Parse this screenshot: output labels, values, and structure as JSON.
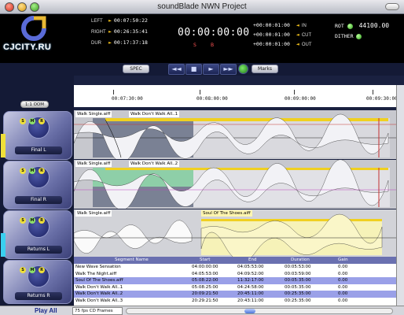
{
  "window": {
    "title": "soundBlade NWN Project"
  },
  "logo": {
    "text": "CJCITY.RU"
  },
  "timecodes": {
    "left": {
      "label": "LEFT",
      "value": "00:07:50:22"
    },
    "right": {
      "label": "RIGHT",
      "value": "00:26:35:41"
    },
    "dur": {
      "label": "DUR",
      "value": "00:17:37:18"
    },
    "main": "00:00:00:00",
    "r1": {
      "label": "IN",
      "value": "+00:00:01:00"
    },
    "r2": {
      "label": "CUT",
      "value": "+00:00:01:00"
    },
    "r3": {
      "label": "OUT",
      "value": "+00:00:01:00"
    },
    "sample_rate": "44100.00",
    "sb_s": "S",
    "sb_b": "B",
    "dither_label": "DITHER",
    "rate_label": "ROT"
  },
  "transport": {
    "left_btn": "SPEC",
    "right_btn": "Marks",
    "rewind": "◄◄",
    "stop": "■",
    "play": "►",
    "ffwd": "►►"
  },
  "zoom": {
    "value": "1:1 OOM"
  },
  "ruler": [
    "00:07:30:00",
    "00:08:00:00",
    "00:09:00:00",
    "00:09:30:00"
  ],
  "tracks": [
    {
      "name": "Final L",
      "clip1": "Walk Single.aiff",
      "clip2": "Walk Don't Walk All..1",
      "accent": "#f0e03a"
    },
    {
      "name": "Final R",
      "clip1": "Walk Single.aiff",
      "clip2": "Walk Don't Walk All..2",
      "accent": "#e8e8ef"
    },
    {
      "name": "Returns L",
      "clip1": "Walk Single.aiff",
      "clip2": "Soul Of The Shoes.aiff",
      "accent": "#3ad0f0"
    },
    {
      "name": "Returns R",
      "clip1": "",
      "clip2": "",
      "accent": "#e8e8ef"
    }
  ],
  "segments": {
    "headers": [
      "Segment Name",
      "Start",
      "End",
      "Duration",
      "Gain"
    ],
    "rows": [
      [
        "New Wave Sensation",
        "04:00:00:00",
        "04:05:53:00",
        "00:05:53:00",
        "0.00"
      ],
      [
        "Walk The Night.aiff",
        "04:05:53:00",
        "04:09:52:00",
        "00:03:59:00",
        "0.00"
      ],
      [
        "Soul Of The Shoes.aiff",
        "05:08:22:00",
        "11:32:17:00",
        "00:05:35:00",
        "0.00"
      ],
      [
        "Walk Don't Walk All..1",
        "05:08:25:00",
        "04:24:58:00",
        "00:05:35:00",
        "0.00"
      ],
      [
        "Walk Don't Walk All..2",
        "20:09:21:50",
        "20:45:11:00",
        "00:25:35:00",
        "0.00"
      ],
      [
        "Walk Don't Walk All..3",
        "20:29:21:50",
        "20:43:11:00",
        "00:25:35:00",
        "0.00"
      ]
    ]
  },
  "bottom": {
    "play_all": "Play All",
    "fps": "75 fps CD Frames"
  }
}
